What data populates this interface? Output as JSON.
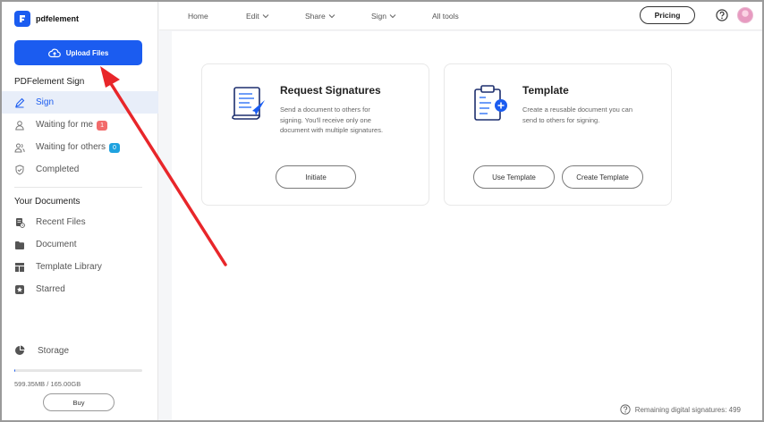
{
  "brand": {
    "name": "pdfelement"
  },
  "sidebar": {
    "upload_label": "Upload Files",
    "sign_section": "PDFelement Sign",
    "sign_items": [
      {
        "label": "Sign",
        "icon": "pen-icon",
        "active": true
      },
      {
        "label": "Waiting for me",
        "icon": "person-icon",
        "badge": "1",
        "badge_color": "#f26b6b"
      },
      {
        "label": "Waiting for others",
        "icon": "people-icon",
        "badge": "0",
        "badge_color": "#1fa2df"
      },
      {
        "label": "Completed",
        "icon": "shield-check-icon"
      }
    ],
    "docs_section": "Your Documents",
    "doc_items": [
      {
        "label": "Recent Files",
        "icon": "recent-files-icon"
      },
      {
        "label": "Document",
        "icon": "folder-icon"
      },
      {
        "label": "Template Library",
        "icon": "template-icon"
      },
      {
        "label": "Starred",
        "icon": "star-icon"
      }
    ],
    "storage": {
      "label": "Storage",
      "usage_text": "599.35MB / 165.00GB",
      "used_fraction": 0.0036
    },
    "buy_label": "Buy"
  },
  "topbar": {
    "nav": [
      {
        "label": "Home",
        "dropdown": false
      },
      {
        "label": "Edit",
        "dropdown": true
      },
      {
        "label": "Share",
        "dropdown": true
      },
      {
        "label": "Sign",
        "dropdown": true
      },
      {
        "label": "All tools",
        "dropdown": false
      }
    ],
    "pricing_label": "Pricing"
  },
  "cards": {
    "request": {
      "title": "Request Signatures",
      "desc_lines": [
        "Send a document to others for",
        "signing. You'll receive only one",
        "document with multiple signatures."
      ],
      "button": "Initiate"
    },
    "template": {
      "title": "Template",
      "desc_lines": [
        "Create a reusable document you can",
        "send to others for signing."
      ],
      "button_use": "Use Template",
      "button_create": "Create Template"
    }
  },
  "footer": {
    "remaining": "Remaining digital signatures: 499"
  },
  "colors": {
    "accent": "#1b5cf0",
    "annotation_arrow": "#e8262a"
  }
}
